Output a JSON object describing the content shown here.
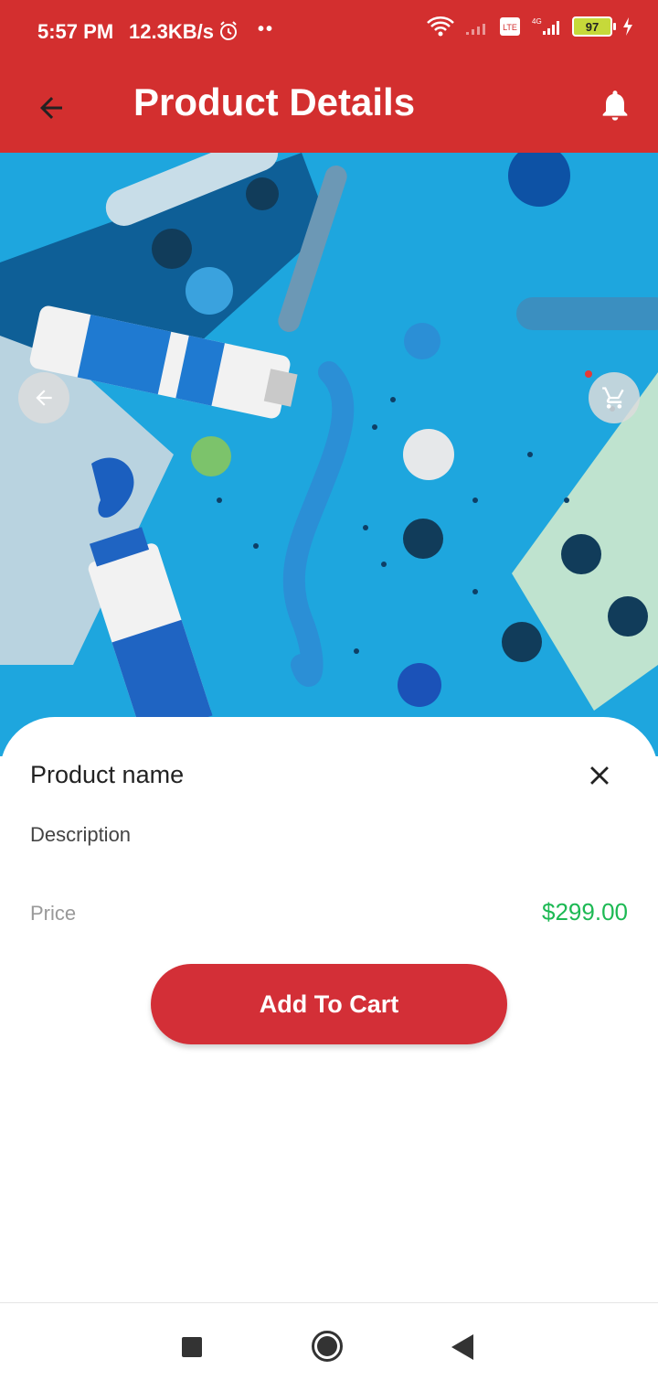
{
  "status_bar": {
    "time": "5:57 PM",
    "speed": "12.3KB/s",
    "dots": "••",
    "battery": "97"
  },
  "app_bar": {
    "title": "Product Details",
    "back_icon": "arrow-left-icon",
    "bell_icon": "bell-icon"
  },
  "hero": {
    "description_image": "craft supplies photo",
    "left_button_icon": "arrow-left-icon",
    "right_button_icon": "cart-icon"
  },
  "product": {
    "name": "Product name",
    "description": "Description",
    "price_label": "Price",
    "price": "$299.00",
    "close_icon": "close-icon"
  },
  "actions": {
    "add_to_cart_label": "Add To Cart"
  },
  "colors": {
    "primary": "#d32f2f",
    "price_green": "#1db954"
  },
  "nav": {
    "recent_icon": "square-icon",
    "home_icon": "circle-icon",
    "back_icon": "triangle-back-icon"
  }
}
